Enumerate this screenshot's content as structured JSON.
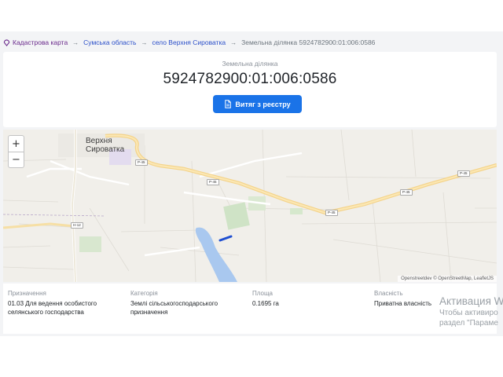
{
  "breadcrumb": {
    "items": [
      "Кадастрова карта",
      "Сумська область",
      "село Верхня Сироватка"
    ],
    "separator": "→",
    "current": "Земельна ділянка 5924782900:01:006:0586",
    "icon": "map-pin-icon"
  },
  "header": {
    "label": "Земельна ділянка",
    "cadastral_number": "5924782900:01:006:0586",
    "extract_button": "Витяг з реєстру",
    "extract_icon": "document-icon",
    "accent_color": "#1a73e8"
  },
  "map": {
    "zoom_in": "+",
    "zoom_out": "−",
    "village_label_line1": "Верхня",
    "village_label_line2": "Сироватка",
    "road_labels": [
      "P-45",
      "P-45",
      "P-45",
      "P-45",
      "P-45",
      "H-12"
    ],
    "attribution": "Openstreetdev © OpenStreetMap, LeafletJS",
    "parcel_color": "#1f4fd1"
  },
  "details": [
    {
      "label": "Призначення",
      "value": "01.03 Для ведення особистого селянського господарства"
    },
    {
      "label": "Категорія",
      "value": "Землі сільськогосподарського призначення"
    },
    {
      "label": "Площа",
      "value": "0.1695 га"
    },
    {
      "label": "Власність",
      "value": "Приватна власність"
    }
  ],
  "watermark": {
    "title": "Активация W",
    "line1": "Чтобы активиро",
    "line2": "раздел \"Параме"
  }
}
